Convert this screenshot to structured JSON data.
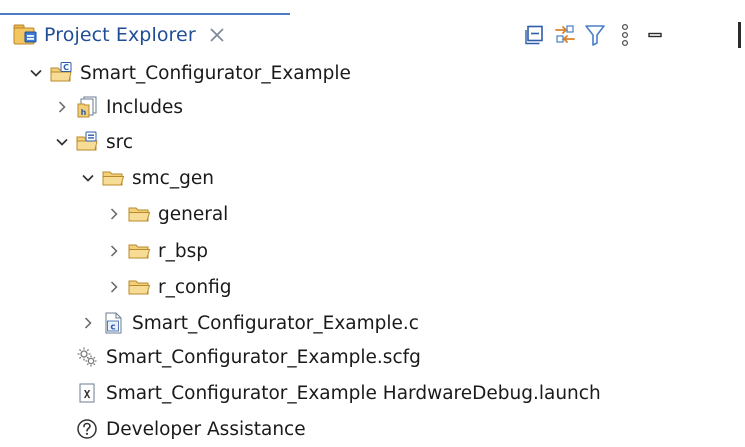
{
  "view": {
    "title": "Project Explorer",
    "tab_icon": "project-explorer-icon",
    "close_icon": "close-icon",
    "accent_color": "#1f4e96"
  },
  "toolbar": {
    "buttons": [
      {
        "name": "collapse-all-icon"
      },
      {
        "name": "link-with-editor-icon"
      },
      {
        "name": "filter-icon"
      },
      {
        "name": "view-menu-icon"
      },
      {
        "name": "minimize-icon"
      }
    ]
  },
  "tree": {
    "items": [
      {
        "label": "Smart_Configurator_Example",
        "depth": 0,
        "state": "expanded",
        "icon": "c-project-icon"
      },
      {
        "label": "Includes",
        "depth": 1,
        "state": "collapsed",
        "icon": "includes-icon"
      },
      {
        "label": "src",
        "depth": 1,
        "state": "expanded",
        "icon": "source-folder-icon"
      },
      {
        "label": "smc_gen",
        "depth": 2,
        "state": "expanded",
        "icon": "folder-icon"
      },
      {
        "label": "general",
        "depth": 3,
        "state": "collapsed",
        "icon": "folder-icon"
      },
      {
        "label": "r_bsp",
        "depth": 3,
        "state": "collapsed",
        "icon": "folder-icon"
      },
      {
        "label": "r_config",
        "depth": 3,
        "state": "collapsed",
        "icon": "folder-icon"
      },
      {
        "label": "Smart_Configurator_Example.c",
        "depth": 1,
        "state": "collapsed",
        "icon": "c-source-file-icon"
      },
      {
        "label": "Smart_Configurator_Example.scfg",
        "depth": 1,
        "state": "leaf",
        "icon": "configuration-gear-icon"
      },
      {
        "label": "Smart_Configurator_Example HardwareDebug.launch",
        "depth": 1,
        "state": "leaf",
        "icon": "launch-config-icon"
      },
      {
        "label": "Developer Assistance",
        "depth": 1,
        "state": "leaf",
        "icon": "help-icon"
      }
    ]
  }
}
